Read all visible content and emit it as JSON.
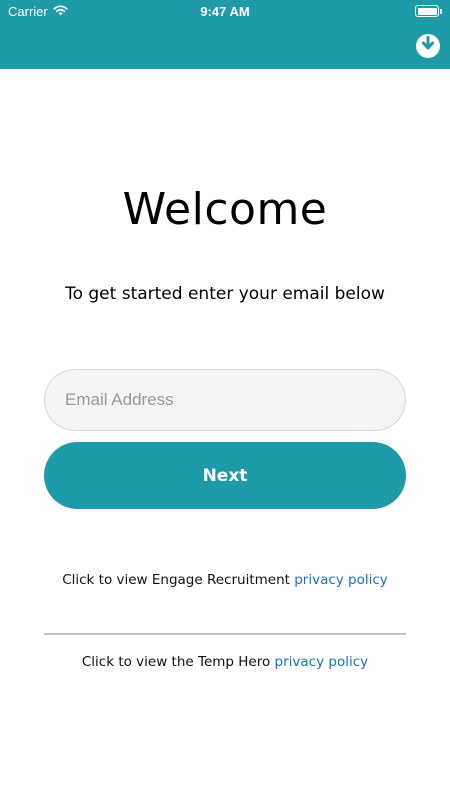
{
  "status_bar": {
    "carrier": "Carrier",
    "time": "9:47 AM"
  },
  "header": {
    "download_icon": "arrow-down-circle",
    "color": "#1e9aa8"
  },
  "main": {
    "title": "Welcome",
    "subtitle": "To get started enter your email below",
    "email_input": {
      "placeholder": "Email Address",
      "value": ""
    },
    "next_label": "Next"
  },
  "footer": {
    "policy_1_prefix": "Click to view Engage Recruitment ",
    "policy_1_link": "privacy policy",
    "policy_2_prefix": "Click to view the Temp Hero ",
    "policy_2_link": "privacy policy",
    "link_color": "#1a6fd6"
  }
}
